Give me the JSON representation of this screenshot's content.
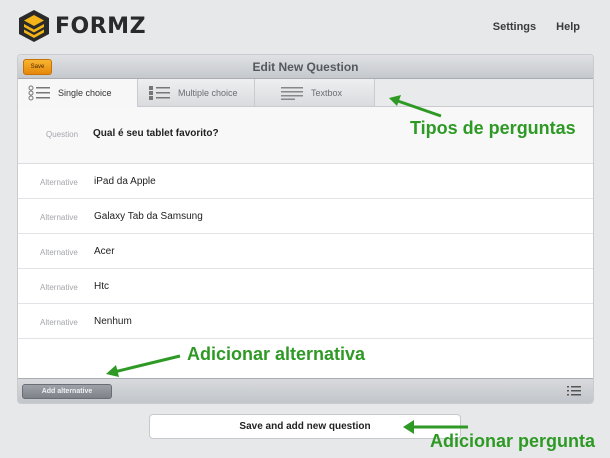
{
  "header": {
    "logo_text": "FORMZ",
    "nav": [
      "Settings",
      "Help"
    ]
  },
  "editor": {
    "save_label": "Save",
    "title": "Edit New Question",
    "tabs": [
      {
        "label": "Single choice",
        "icon": "single-choice-icon",
        "active": true
      },
      {
        "label": "Multiple choice",
        "icon": "multiple-choice-icon",
        "active": false
      },
      {
        "label": "Textbox",
        "icon": "textbox-icon",
        "active": false
      }
    ],
    "question": {
      "label": "Question",
      "text": "Qual é seu tablet favorito?"
    },
    "alternatives": [
      {
        "label": "Alternative",
        "text": "iPad da Apple"
      },
      {
        "label": "Alternative",
        "text": "Galaxy Tab da Samsung"
      },
      {
        "label": "Alternative",
        "text": "Acer"
      },
      {
        "label": "Alternative",
        "text": "Htc"
      },
      {
        "label": "Alternative",
        "text": "Nenhum"
      }
    ],
    "add_alternative_label": "Add alternative"
  },
  "save_and_add_label": "Save and add new question",
  "annotations": {
    "question_types": "Tipos de perguntas",
    "add_alternative": "Adicionar alternativa",
    "add_question": "Adicionar pergunta"
  },
  "colors": {
    "accent_orange": "#f0a020",
    "annotation_green": "#2e9a25",
    "logo_yellow": "#f2b418"
  }
}
